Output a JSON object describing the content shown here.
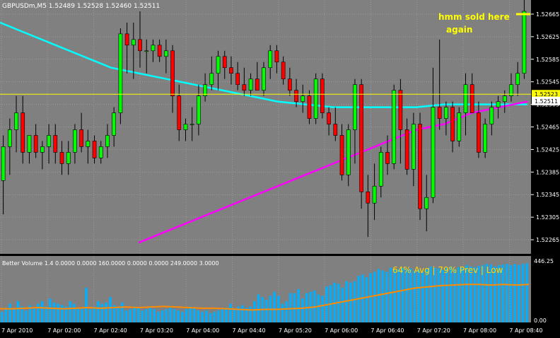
{
  "symbol_header": "GBPUSDm,M5  1.52489 1.52528 1.52460 1.52511",
  "annotation": {
    "line1": "hmm sold here",
    "line2": "again"
  },
  "volume_indicator": {
    "header": "Better Volume 1.4 0.0000 0.0000 160.0000 0.0000 0.0000 249.0000 3.0000",
    "stats": "64% Avg | 79% Prev | Low",
    "scale_max": "446.25",
    "scale_min": "0.00"
  },
  "price_axis": {
    "ticks": [
      "1.52665",
      "1.52625",
      "1.52585",
      "1.52545",
      "1.52505",
      "1.52465",
      "1.52425",
      "1.52385",
      "1.52345",
      "1.52305",
      "1.52265"
    ],
    "hline_label": "1.52523",
    "current_label": "1.52511"
  },
  "time_axis": [
    "7 Apr 2010",
    "7 Apr 02:00",
    "7 Apr 02:40",
    "7 Apr 03:20",
    "7 Apr 04:00",
    "7 Apr 04:40",
    "7 Apr 05:20",
    "7 Apr 06:00",
    "7 Apr 06:40",
    "7 Apr 07:20",
    "7 Apr 08:00",
    "7 Apr 08:40"
  ],
  "colors": {
    "background": "#808080",
    "bull": "#00ff00",
    "bear": "#ff0000",
    "fast_ma": "#00ffff",
    "slow_ma": "#ff00ff",
    "hline": "#ffff00",
    "volume_normal": "#00b0ff",
    "volume_climax": "#ff0000",
    "volume_low": "#ffff00",
    "volume_churn": "#008000",
    "volume_avg": "#ff8c00",
    "text": "#ffffff"
  },
  "chart_data": [
    {
      "type": "candlestick",
      "title": "GBPUSDm,M5",
      "ylim": [
        1.5224,
        1.5269
      ],
      "ohlc": [
        {
          "o": 1.5237,
          "h": 1.5245,
          "l": 1.5231,
          "c": 1.5243
        },
        {
          "o": 1.5243,
          "h": 1.5248,
          "l": 1.5238,
          "c": 1.5246
        },
        {
          "o": 1.5246,
          "h": 1.5252,
          "l": 1.5242,
          "c": 1.5249
        },
        {
          "o": 1.5249,
          "h": 1.5252,
          "l": 1.524,
          "c": 1.5242
        },
        {
          "o": 1.5242,
          "h": 1.5245,
          "l": 1.524,
          "c": 1.5245
        },
        {
          "o": 1.5245,
          "h": 1.5247,
          "l": 1.5241,
          "c": 1.5242
        },
        {
          "o": 1.5242,
          "h": 1.5244,
          "l": 1.5239,
          "c": 1.5243
        },
        {
          "o": 1.5243,
          "h": 1.5247,
          "l": 1.524,
          "c": 1.5245
        },
        {
          "o": 1.5245,
          "h": 1.5247,
          "l": 1.524,
          "c": 1.5242
        },
        {
          "o": 1.5242,
          "h": 1.5244,
          "l": 1.5238,
          "c": 1.524
        },
        {
          "o": 1.524,
          "h": 1.5244,
          "l": 1.5238,
          "c": 1.5242
        },
        {
          "o": 1.5242,
          "h": 1.5247,
          "l": 1.524,
          "c": 1.5246
        },
        {
          "o": 1.5246,
          "h": 1.5249,
          "l": 1.5242,
          "c": 1.5243
        },
        {
          "o": 1.5243,
          "h": 1.5246,
          "l": 1.524,
          "c": 1.5244
        },
        {
          "o": 1.5244,
          "h": 1.5245,
          "l": 1.524,
          "c": 1.5241
        },
        {
          "o": 1.5241,
          "h": 1.5244,
          "l": 1.524,
          "c": 1.5243
        },
        {
          "o": 1.5243,
          "h": 1.5247,
          "l": 1.5241,
          "c": 1.5245
        },
        {
          "o": 1.5245,
          "h": 1.525,
          "l": 1.5243,
          "c": 1.5249
        },
        {
          "o": 1.5249,
          "h": 1.5264,
          "l": 1.5247,
          "c": 1.5263
        },
        {
          "o": 1.5263,
          "h": 1.5265,
          "l": 1.5256,
          "c": 1.5261
        },
        {
          "o": 1.5261,
          "h": 1.5265,
          "l": 1.5255,
          "c": 1.5262
        },
        {
          "o": 1.5262,
          "h": 1.5267,
          "l": 1.5257,
          "c": 1.526
        },
        {
          "o": 1.526,
          "h": 1.5262,
          "l": 1.5256,
          "c": 1.526
        },
        {
          "o": 1.526,
          "h": 1.5262,
          "l": 1.5258,
          "c": 1.5261
        },
        {
          "o": 1.5261,
          "h": 1.5262,
          "l": 1.5258,
          "c": 1.5259
        },
        {
          "o": 1.5259,
          "h": 1.5262,
          "l": 1.5256,
          "c": 1.526
        },
        {
          "o": 1.526,
          "h": 1.5261,
          "l": 1.5249,
          "c": 1.5252
        },
        {
          "o": 1.5252,
          "h": 1.5254,
          "l": 1.5244,
          "c": 1.5246
        },
        {
          "o": 1.5246,
          "h": 1.5248,
          "l": 1.5244,
          "c": 1.5247
        },
        {
          "o": 1.5247,
          "h": 1.525,
          "l": 1.5244,
          "c": 1.5247
        },
        {
          "o": 1.5247,
          "h": 1.5254,
          "l": 1.5245,
          "c": 1.5252
        },
        {
          "o": 1.5252,
          "h": 1.5256,
          "l": 1.5251,
          "c": 1.5254
        },
        {
          "o": 1.5254,
          "h": 1.5259,
          "l": 1.5253,
          "c": 1.5256
        },
        {
          "o": 1.5256,
          "h": 1.526,
          "l": 1.5253,
          "c": 1.5259
        },
        {
          "o": 1.5259,
          "h": 1.526,
          "l": 1.5255,
          "c": 1.5257
        },
        {
          "o": 1.5257,
          "h": 1.5259,
          "l": 1.5254,
          "c": 1.5256
        },
        {
          "o": 1.5256,
          "h": 1.5258,
          "l": 1.5253,
          "c": 1.5254
        },
        {
          "o": 1.5254,
          "h": 1.5257,
          "l": 1.5252,
          "c": 1.5253
        },
        {
          "o": 1.5253,
          "h": 1.5256,
          "l": 1.5252,
          "c": 1.5255
        },
        {
          "o": 1.5255,
          "h": 1.5258,
          "l": 1.5253,
          "c": 1.5253
        },
        {
          "o": 1.5253,
          "h": 1.5258,
          "l": 1.5252,
          "c": 1.5257
        },
        {
          "o": 1.5257,
          "h": 1.5261,
          "l": 1.5255,
          "c": 1.526
        },
        {
          "o": 1.526,
          "h": 1.5261,
          "l": 1.5256,
          "c": 1.5258
        },
        {
          "o": 1.5258,
          "h": 1.5259,
          "l": 1.5254,
          "c": 1.5255
        },
        {
          "o": 1.5255,
          "h": 1.5257,
          "l": 1.5252,
          "c": 1.5253
        },
        {
          "o": 1.5253,
          "h": 1.5255,
          "l": 1.525,
          "c": 1.5251
        },
        {
          "o": 1.5251,
          "h": 1.5254,
          "l": 1.5249,
          "c": 1.5252
        },
        {
          "o": 1.5252,
          "h": 1.5253,
          "l": 1.5247,
          "c": 1.5248
        },
        {
          "o": 1.5248,
          "h": 1.5256,
          "l": 1.5247,
          "c": 1.5255
        },
        {
          "o": 1.5255,
          "h": 1.5256,
          "l": 1.5248,
          "c": 1.5249
        },
        {
          "o": 1.5249,
          "h": 1.525,
          "l": 1.5245,
          "c": 1.5247
        },
        {
          "o": 1.5247,
          "h": 1.525,
          "l": 1.5244,
          "c": 1.5245
        },
        {
          "o": 1.5245,
          "h": 1.5247,
          "l": 1.5237,
          "c": 1.5238
        },
        {
          "o": 1.5238,
          "h": 1.5247,
          "l": 1.5236,
          "c": 1.5246
        },
        {
          "o": 1.5246,
          "h": 1.5255,
          "l": 1.524,
          "c": 1.5254
        },
        {
          "o": 1.5254,
          "h": 1.5255,
          "l": 1.5232,
          "c": 1.5235
        },
        {
          "o": 1.5235,
          "h": 1.5238,
          "l": 1.5227,
          "c": 1.5233
        },
        {
          "o": 1.5233,
          "h": 1.524,
          "l": 1.523,
          "c": 1.5236
        },
        {
          "o": 1.5236,
          "h": 1.5243,
          "l": 1.5234,
          "c": 1.5242
        },
        {
          "o": 1.5242,
          "h": 1.5245,
          "l": 1.5238,
          "c": 1.524
        },
        {
          "o": 1.524,
          "h": 1.5254,
          "l": 1.5239,
          "c": 1.5253
        },
        {
          "o": 1.5253,
          "h": 1.5255,
          "l": 1.524,
          "c": 1.5246
        },
        {
          "o": 1.5246,
          "h": 1.5248,
          "l": 1.5238,
          "c": 1.5239
        },
        {
          "o": 1.5239,
          "h": 1.5249,
          "l": 1.5236,
          "c": 1.5247
        },
        {
          "o": 1.5247,
          "h": 1.5249,
          "l": 1.523,
          "c": 1.5232
        },
        {
          "o": 1.5232,
          "h": 1.5238,
          "l": 1.5228,
          "c": 1.5234
        },
        {
          "o": 1.5234,
          "h": 1.5257,
          "l": 1.5233,
          "c": 1.525
        },
        {
          "o": 1.525,
          "h": 1.5262,
          "l": 1.5246,
          "c": 1.5248
        },
        {
          "o": 1.5248,
          "h": 1.5251,
          "l": 1.5245,
          "c": 1.525
        },
        {
          "o": 1.525,
          "h": 1.5251,
          "l": 1.5242,
          "c": 1.5244
        },
        {
          "o": 1.5244,
          "h": 1.525,
          "l": 1.5243,
          "c": 1.5249
        },
        {
          "o": 1.5249,
          "h": 1.5256,
          "l": 1.5245,
          "c": 1.5254
        },
        {
          "o": 1.5254,
          "h": 1.5256,
          "l": 1.5249,
          "c": 1.5249
        },
        {
          "o": 1.5249,
          "h": 1.5251,
          "l": 1.5241,
          "c": 1.5242
        },
        {
          "o": 1.5242,
          "h": 1.5248,
          "l": 1.5241,
          "c": 1.5247
        },
        {
          "o": 1.5247,
          "h": 1.5251,
          "l": 1.5245,
          "c": 1.525
        },
        {
          "o": 1.525,
          "h": 1.5252,
          "l": 1.5248,
          "c": 1.5251
        },
        {
          "o": 1.5251,
          "h": 1.5253,
          "l": 1.5249,
          "c": 1.5252
        },
        {
          "o": 1.5252,
          "h": 1.5256,
          "l": 1.5251,
          "c": 1.5254
        },
        {
          "o": 1.5254,
          "h": 1.5258,
          "l": 1.5252,
          "c": 1.5256
        },
        {
          "o": 1.5256,
          "h": 1.5269,
          "l": 1.5255,
          "c": 1.5267
        }
      ],
      "hline": 1.52523,
      "current_price": 1.52511,
      "fast_ma": [
        1.5265,
        1.5263,
        1.5261,
        1.5259,
        1.5257,
        1.5256,
        1.5255,
        1.5254,
        1.5253,
        1.5252,
        1.5251,
        1.52505,
        1.525,
        1.525,
        1.525,
        1.525,
        1.52505,
        1.52505,
        1.52505,
        1.52505
      ],
      "slow_ma": [
        null,
        null,
        null,
        null,
        null,
        1.5226,
        1.5228,
        1.523,
        1.5232,
        1.5234,
        1.5236,
        1.5238,
        1.524,
        1.5242,
        1.5244,
        1.5246,
        1.5247,
        1.5249,
        1.525,
        1.5251
      ]
    },
    {
      "type": "bar",
      "title": "Better Volume 1.4",
      "ylim": [
        0,
        446.25
      ],
      "values": [
        80,
        110,
        140,
        100,
        160,
        120,
        90,
        130,
        110,
        140,
        160,
        120,
        180,
        150,
        140,
        130,
        120,
        160,
        140,
        110,
        110,
        260,
        100,
        120,
        160,
        140,
        150,
        190,
        130,
        120,
        150,
        90,
        100,
        120,
        110,
        90,
        100,
        110,
        100,
        80,
        90,
        100,
        110,
        100,
        90,
        80,
        100,
        120,
        110,
        90,
        80,
        90,
        70,
        80,
        90,
        100,
        110,
        140,
        100,
        120,
        130,
        110,
        120,
        160,
        210,
        190,
        170,
        200,
        230,
        200,
        140,
        160,
        220,
        220,
        250,
        180,
        220,
        230,
        240,
        210,
        200,
        270,
        280,
        300,
        290,
        260,
        310,
        300,
        310,
        350,
        360,
        340,
        370,
        380,
        400,
        390,
        380,
        410,
        395,
        400,
        410,
        400,
        405,
        390,
        395,
        380,
        400,
        420,
        410,
        405,
        395,
        410,
        420,
        400,
        415,
        410,
        430,
        420,
        415,
        425,
        430,
        440,
        435,
        420,
        430,
        435,
        440,
        430,
        438,
        432,
        440,
        445
      ],
      "avg": [
        0.23,
        0.23,
        0.24,
        0.25,
        0.24,
        0.23,
        0.24,
        0.25,
        0.24,
        0.25,
        0.26,
        0.25,
        0.26,
        0.27,
        0.26,
        0.25,
        0.24,
        0.24,
        0.23,
        0.22,
        0.21,
        0.22,
        0.22,
        0.23,
        0.24,
        0.26,
        0.3,
        0.34,
        0.38,
        0.42,
        0.46,
        0.5,
        0.54,
        0.58,
        0.6,
        0.62,
        0.63,
        0.64,
        0.64,
        0.63,
        0.64,
        0.63,
        0.64
      ],
      "color_codes": "nnnnnnnnnnnnnnnnnnnnnnnnnnnnnnnnnnnnnnnnnnnnnnnnnnnnnnnnnnnnnnnnnnnnnnnnnnnnnnnnnnnnnnnnnnnnnnnnnnnnnnnnnnnnnnnnnnnnnnnnnnnnnnnnnnn"
    }
  ]
}
